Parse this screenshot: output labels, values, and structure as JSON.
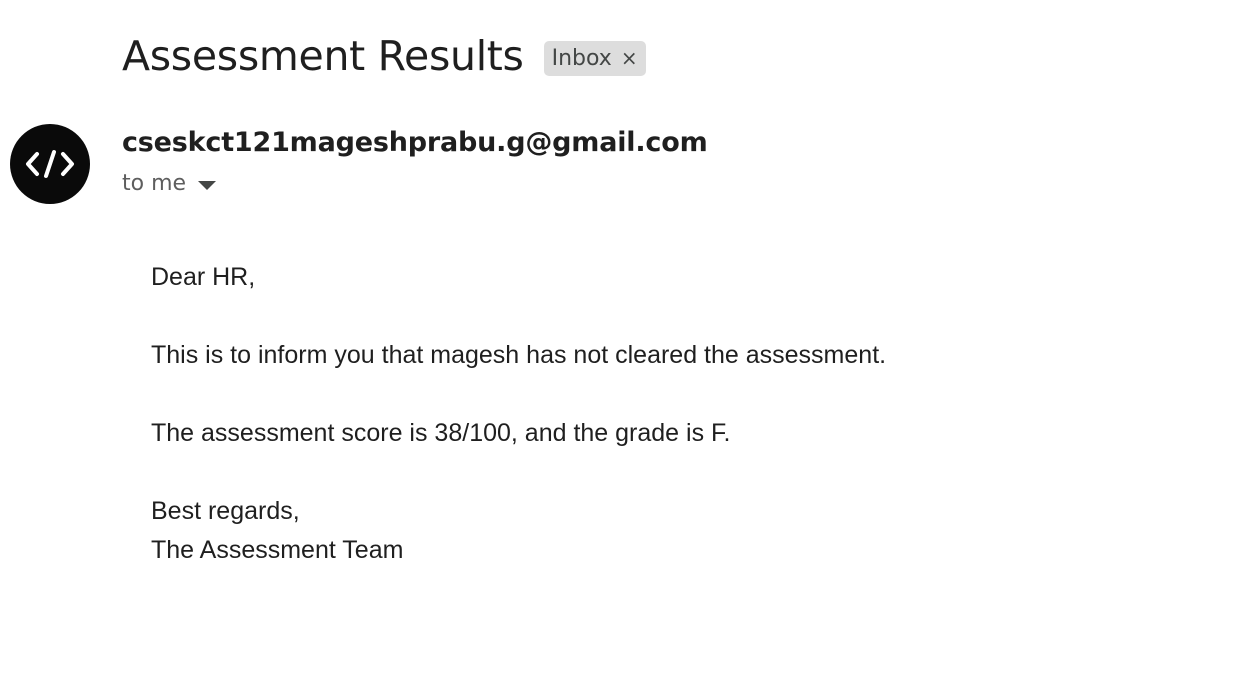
{
  "email": {
    "subject": "Assessment Results",
    "label": "Inbox",
    "label_close": "×",
    "sender": "cseskct121mageshprabu.g@gmail.com",
    "recipient": "to me",
    "body": {
      "greeting": "Dear HR,",
      "line1": "This is to inform you that magesh has not cleared the assessment.",
      "line2": "The assessment score is 38/100, and the grade is F.",
      "closing": "Best regards,",
      "signature": "The Assessment Team"
    }
  },
  "icons": {
    "avatar": "code-brackets-icon",
    "recipient_details": "caret-down-icon"
  },
  "colors": {
    "avatar_bg": "#0a0a0a",
    "chip_bg": "#dddddd",
    "text": "#1f1f1f",
    "muted": "#5e5e5e"
  }
}
